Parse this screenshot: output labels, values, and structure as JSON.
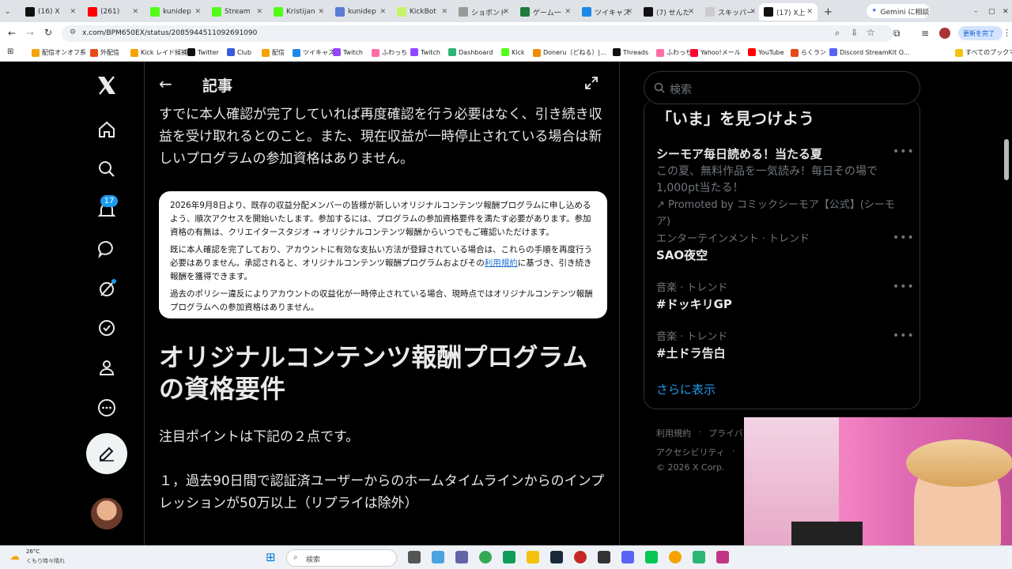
{
  "browser": {
    "tabs": [
      {
        "label": "(16) X",
        "color": "#111111"
      },
      {
        "label": "(261)",
        "color": "#ff0000"
      },
      {
        "label": "kunidep",
        "color": "#53fc18"
      },
      {
        "label": "Stream",
        "color": "#53fc18"
      },
      {
        "label": "Kristijan",
        "color": "#53fc18"
      },
      {
        "label": "kunidep",
        "color": "#5b7bd5"
      },
      {
        "label": "KickBot",
        "color": "#c8f26b"
      },
      {
        "label": "ショボンド",
        "color": "#999999"
      },
      {
        "label": "ゲーム一",
        "color": "#1e7a3c"
      },
      {
        "label": "ツイキャス",
        "color": "#1e88e5"
      },
      {
        "label": "(7) せんた",
        "color": "#111111"
      },
      {
        "label": "スキッパー",
        "color": "#cccccc"
      },
      {
        "label": "(17) X上",
        "color": "#111111"
      }
    ],
    "new_tab": "+",
    "gemini_button": "Gemini に相談",
    "url": "x.com/BPM650EX/status/2085944511092691090",
    "update_button": "更新を完了",
    "bookmarks": [
      {
        "label": "配信オンオフ系",
        "color": "#f4a300"
      },
      {
        "label": "外配信",
        "color": "#e64a19"
      },
      {
        "label": "Kick レイド候補",
        "color": "#f4a300"
      },
      {
        "label": "Twitter",
        "color": "#111111"
      },
      {
        "label": "Club",
        "color": "#3b5bdb"
      },
      {
        "label": "配信",
        "color": "#f4a300"
      },
      {
        "label": "ツイキャス",
        "color": "#1e88e5"
      },
      {
        "label": "Twitch",
        "color": "#9146ff"
      },
      {
        "label": "ふわっち",
        "color": "#ff6fa5"
      },
      {
        "label": "Twitch",
        "color": "#9146ff"
      },
      {
        "label": "Dashboard",
        "color": "#2bb673"
      },
      {
        "label": "Kick",
        "color": "#53fc18"
      },
      {
        "label": "Doneru（どねる）|...",
        "color": "#f08c00"
      },
      {
        "label": "Threads",
        "color": "#111111"
      },
      {
        "label": "ふわっち",
        "color": "#ff6fa5"
      },
      {
        "label": "Yahoo!メール",
        "color": "#ff0033"
      },
      {
        "label": "YouTube",
        "color": "#ff0000"
      },
      {
        "label": "らくラン",
        "color": "#e64a19"
      },
      {
        "label": "Discord StreamKit O...",
        "color": "#5865f2"
      }
    ],
    "all_bookmarks": "すべてのブックマーク"
  },
  "nav": {
    "notification_count": "17"
  },
  "article": {
    "header_title": "記事",
    "lead_paragraph": "すでに本人確認が完了していれば再度確認を行う必要はなく、引き続き収益を受け取れるとのこと。また、現在収益が一時停止されている場合は新しいプログラムの参加資格はありません。",
    "quote": {
      "p1": "2026年9月8日より、既存の収益分配メンバーの皆様が新しいオリジナルコンテンツ報酬プログラムに申し込めるよう、順次アクセスを開始いたします。参加するには、プログラムの参加資格要件を満たす必要があります。参加資格の有無は、クリエイタースタジオ → オリジナルコンテンツ報酬からいつでもご確認いただけます。",
      "p2_before": "既に本人確認を完了しており、アカウントに有効な支払い方法が登録されている場合は、これらの手順を再度行う必要はありません。承認されると、オリジナルコンテンツ報酬プログラムおよびその",
      "p2_link": "利用規約",
      "p2_after": "に基づき、引き続き報酬を獲得できます。",
      "p3": "過去のポリシー違反によりアカウントの収益化が一時停止されている場合、現時点ではオリジナルコンテンツ報酬プログラムへの参加資格はありません。"
    },
    "heading": "オリジナルコンテンツ報酬プログラムの資格要件",
    "points_intro": "注目ポイントは下記の２点です。",
    "point1": "１，過去90日間で認証済ユーザーからのホームタイムラインからのインプレッションが50万以上（リプライは除外）"
  },
  "sidebar": {
    "search_placeholder": "検索",
    "trends_title": "「いま」を見つけよう",
    "promo": {
      "title": "シーモア毎日読める！当たる夏",
      "desc": "この夏、無料作品を一気読み！毎日その場で1,000pt当たる！",
      "promoted": "Promoted by コミックシーモア【公式】(シーモア)"
    },
    "trends": [
      {
        "category": "エンターテインメント · トレンド",
        "name": "SAO夜空"
      },
      {
        "category": "音楽 · トレンド",
        "name": "#ドッキリGP"
      },
      {
        "category": "音楽 · トレンド",
        "name": "#土ドラ告白"
      }
    ],
    "show_more": "さらに表示",
    "footer": {
      "terms": "利用規約",
      "privacy": "プライバ",
      "accessibility": "アクセシビリティ",
      "copyright": "© 2026 X Corp."
    }
  },
  "taskbar": {
    "weather_temp": "26°C",
    "weather_desc": "くもり時々晴れ",
    "search_placeholder": "検索"
  }
}
